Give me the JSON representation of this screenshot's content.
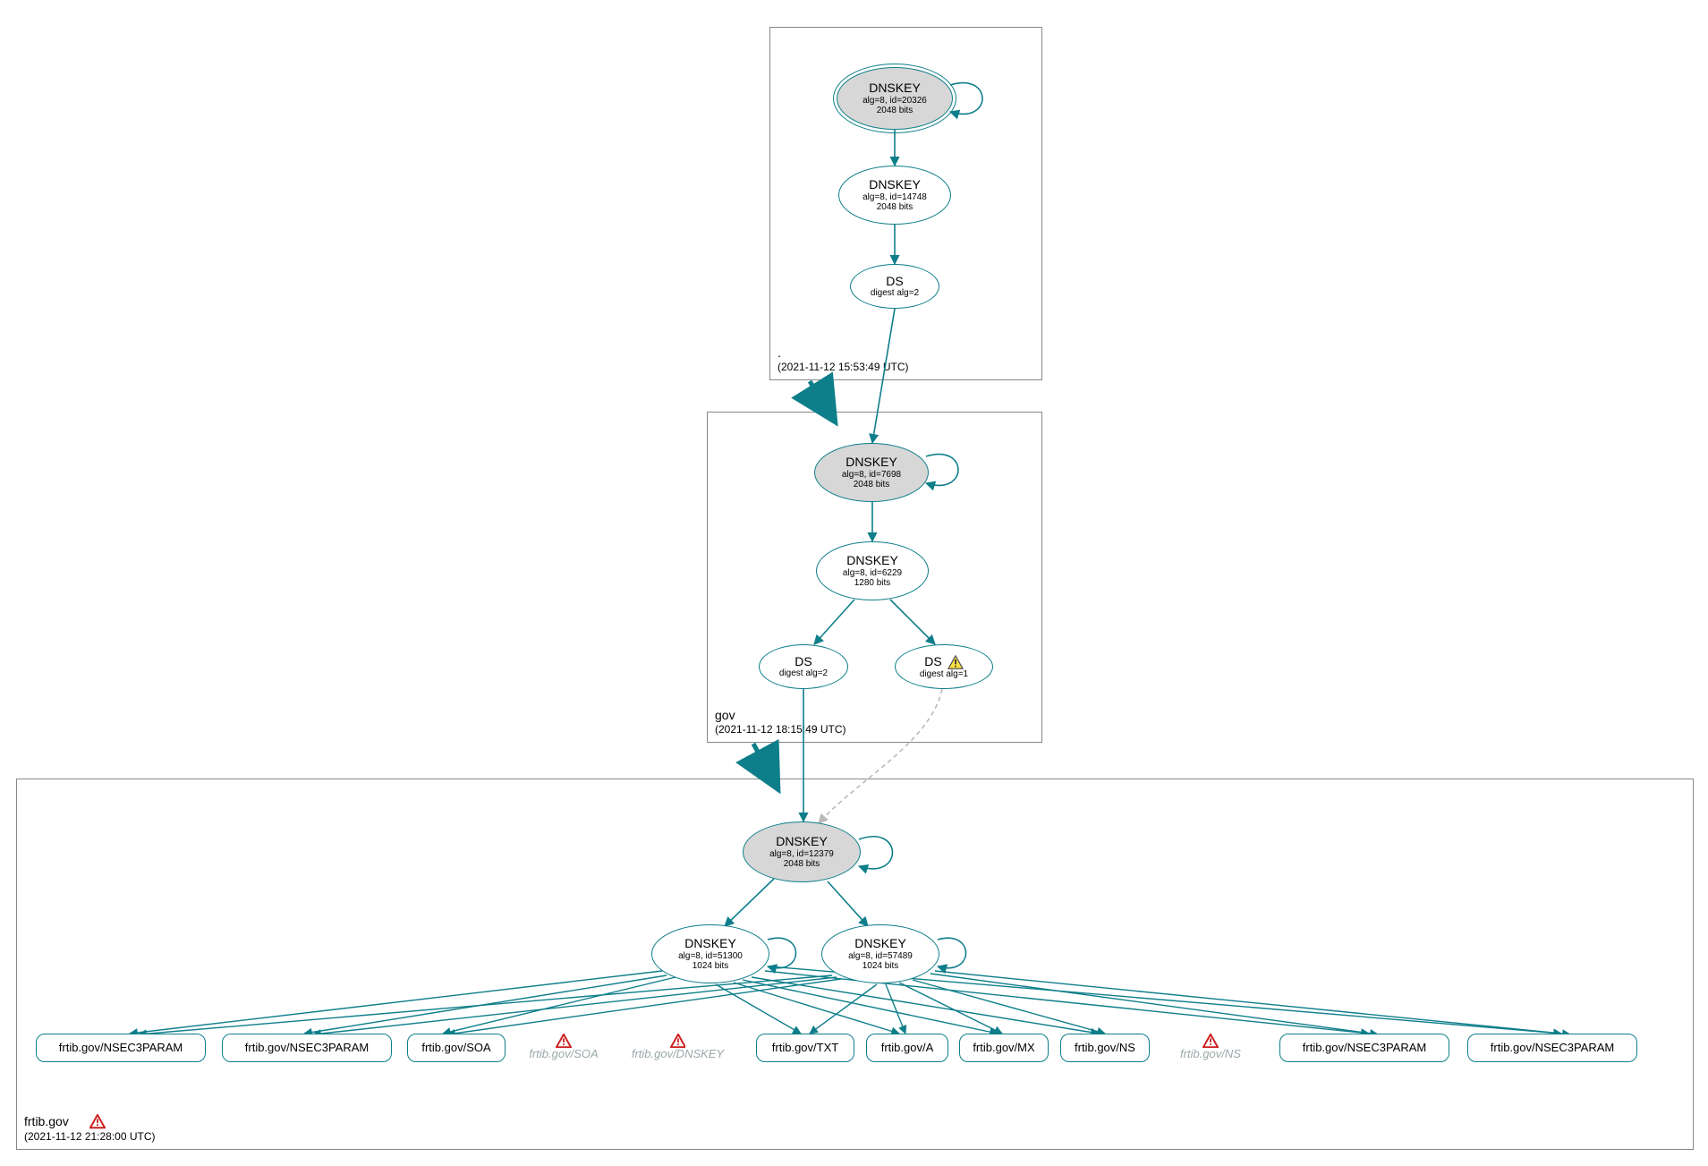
{
  "colors": {
    "stroke": "#0e7e8a",
    "zoneBorder": "#888888",
    "ksk_fill": "#d7d7d7",
    "phantom": "#9aa8aa",
    "warn_fill": "#ffe040",
    "warn_stroke": "#555555",
    "error_stroke": "#cc2020",
    "dashed": "#b9b9b9"
  },
  "zones": {
    "root": {
      "name": ".",
      "timestamp": "(2021-11-12 15:53:49 UTC)"
    },
    "gov": {
      "name": "gov",
      "timestamp": "(2021-11-12 18:15:49 UTC)"
    },
    "frtib": {
      "name": "frtib.gov",
      "timestamp": "(2021-11-12 21:28:00 UTC)",
      "has_error": true
    }
  },
  "nodes": {
    "root_ksk": {
      "title": "DNSKEY",
      "sub1": "alg=8, id=20326",
      "sub2": "2048 bits"
    },
    "root_zsk": {
      "title": "DNSKEY",
      "sub1": "alg=8, id=14748",
      "sub2": "2048 bits"
    },
    "root_ds": {
      "title": "DS",
      "sub1": "digest alg=2"
    },
    "gov_ksk": {
      "title": "DNSKEY",
      "sub1": "alg=8, id=7698",
      "sub2": "2048 bits"
    },
    "gov_zsk": {
      "title": "DNSKEY",
      "sub1": "alg=8, id=6229",
      "sub2": "1280 bits"
    },
    "gov_ds1": {
      "title": "DS",
      "sub1": "digest alg=2"
    },
    "gov_ds2": {
      "title": "DS",
      "sub1": "digest alg=1",
      "warn": true
    },
    "frtib_ksk": {
      "title": "DNSKEY",
      "sub1": "alg=8, id=12379",
      "sub2": "2048 bits"
    },
    "frtib_zsk1": {
      "title": "DNSKEY",
      "sub1": "alg=8, id=51300",
      "sub2": "1024 bits"
    },
    "frtib_zsk2": {
      "title": "DNSKEY",
      "sub1": "alg=8, id=57489",
      "sub2": "1024 bits"
    }
  },
  "rrsets": [
    {
      "id": "rr0",
      "label": "frtib.gov/NSEC3PARAM"
    },
    {
      "id": "rr1",
      "label": "frtib.gov/NSEC3PARAM"
    },
    {
      "id": "rr2",
      "label": "frtib.gov/SOA"
    },
    {
      "id": "rr3p",
      "label": "frtib.gov/SOA",
      "phantom": true,
      "error": true
    },
    {
      "id": "rr4p",
      "label": "frtib.gov/DNSKEY",
      "phantom": true,
      "error": true
    },
    {
      "id": "rr5",
      "label": "frtib.gov/TXT"
    },
    {
      "id": "rr6",
      "label": "frtib.gov/A"
    },
    {
      "id": "rr7",
      "label": "frtib.gov/MX"
    },
    {
      "id": "rr8",
      "label": "frtib.gov/NS"
    },
    {
      "id": "rr9p",
      "label": "frtib.gov/NS",
      "phantom": true,
      "error": true
    },
    {
      "id": "rr10",
      "label": "frtib.gov/NSEC3PARAM"
    },
    {
      "id": "rr11",
      "label": "frtib.gov/NSEC3PARAM"
    }
  ]
}
